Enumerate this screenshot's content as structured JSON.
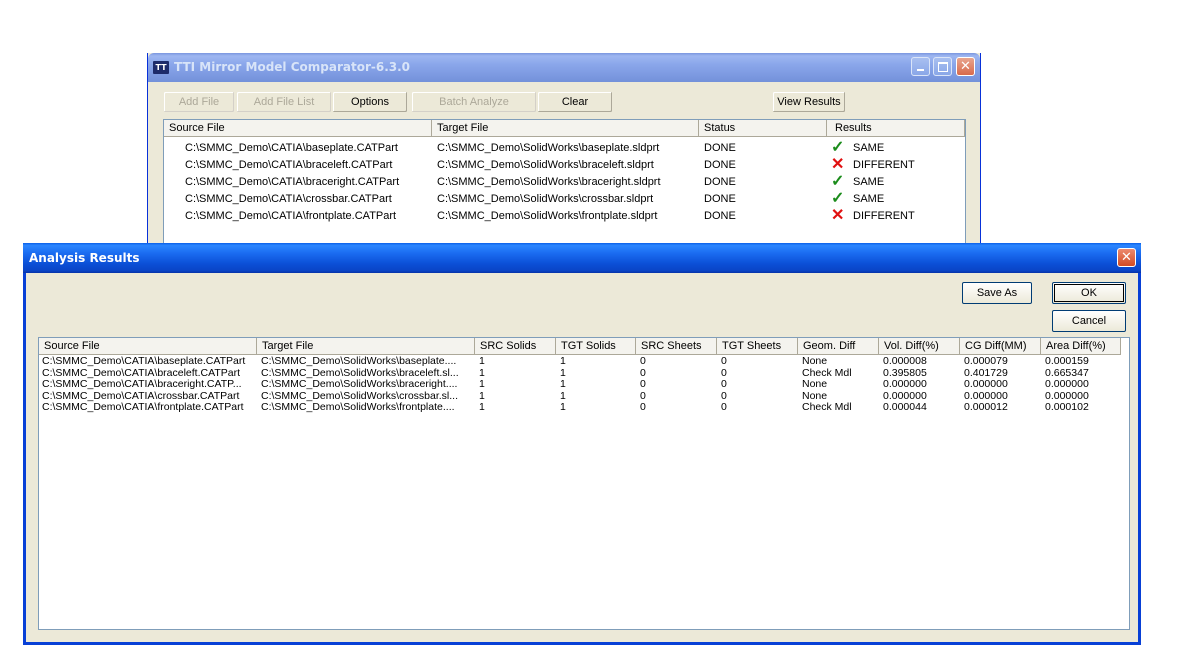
{
  "main_window": {
    "title": "TTI Mirror Model Comparator-6.3.0",
    "toolbar": {
      "add_file": "Add File",
      "add_file_list": "Add File List",
      "options": "Options",
      "batch_analyze": "Batch Analyze",
      "clear": "Clear",
      "view_results": "View Results"
    },
    "columns": [
      "Source File",
      "Target File",
      "Status",
      "Results"
    ],
    "rows": [
      {
        "source": "C:\\SMMC_Demo\\CATIA\\baseplate.CATPart",
        "target": "C:\\SMMC_Demo\\SolidWorks\\baseplate.sldprt",
        "status": "DONE",
        "result": "SAME",
        "icon": "check-icon"
      },
      {
        "source": "C:\\SMMC_Demo\\CATIA\\braceleft.CATPart",
        "target": "C:\\SMMC_Demo\\SolidWorks\\braceleft.sldprt",
        "status": "DONE",
        "result": "DIFFERENT",
        "icon": "cross-icon"
      },
      {
        "source": "C:\\SMMC_Demo\\CATIA\\braceright.CATPart",
        "target": "C:\\SMMC_Demo\\SolidWorks\\braceright.sldprt",
        "status": "DONE",
        "result": "SAME",
        "icon": "check-icon"
      },
      {
        "source": "C:\\SMMC_Demo\\CATIA\\crossbar.CATPart",
        "target": "C:\\SMMC_Demo\\SolidWorks\\crossbar.sldprt",
        "status": "DONE",
        "result": "SAME",
        "icon": "check-icon"
      },
      {
        "source": "C:\\SMMC_Demo\\CATIA\\frontplate.CATPart",
        "target": "C:\\SMMC_Demo\\SolidWorks\\frontplate.sldprt",
        "status": "DONE",
        "result": "DIFFERENT",
        "icon": "cross-icon"
      }
    ]
  },
  "results_window": {
    "title": "Analysis Results",
    "buttons": {
      "save_as": "Save As",
      "ok": "OK",
      "cancel": "Cancel"
    },
    "columns": [
      "Source File",
      "Target File",
      "SRC Solids",
      "TGT Solids",
      "SRC Sheets",
      "TGT Sheets",
      "Geom. Diff",
      "Vol. Diff(%)",
      "CG Diff(MM)",
      "Area Diff(%)"
    ],
    "rows": [
      [
        "C:\\SMMC_Demo\\CATIA\\baseplate.CATPart",
        "C:\\SMMC_Demo\\SolidWorks\\baseplate....",
        "1",
        "1",
        "0",
        "0",
        "None",
        "0.000008",
        "0.000079",
        "0.000159"
      ],
      [
        "C:\\SMMC_Demo\\CATIA\\braceleft.CATPart",
        "C:\\SMMC_Demo\\SolidWorks\\braceleft.sl...",
        "1",
        "1",
        "0",
        "0",
        "Check Mdl",
        "0.395805",
        "0.401729",
        "0.665347"
      ],
      [
        "C:\\SMMC_Demo\\CATIA\\braceright.CATP...",
        "C:\\SMMC_Demo\\SolidWorks\\braceright....",
        "1",
        "1",
        "0",
        "0",
        "None",
        "0.000000",
        "0.000000",
        "0.000000"
      ],
      [
        "C:\\SMMC_Demo\\CATIA\\crossbar.CATPart",
        "C:\\SMMC_Demo\\SolidWorks\\crossbar.sl...",
        "1",
        "1",
        "0",
        "0",
        "None",
        "0.000000",
        "0.000000",
        "0.000000"
      ],
      [
        "C:\\SMMC_Demo\\CATIA\\frontplate.CATPart",
        "C:\\SMMC_Demo\\SolidWorks\\frontplate....",
        "1",
        "1",
        "0",
        "0",
        "Check Mdl",
        "0.000044",
        "0.000012",
        "0.000102"
      ]
    ]
  },
  "colors": {
    "titlebar_active": "#0a5fe8",
    "titlebar_inactive": "#7a96df",
    "window_face": "#ece9d8",
    "same": "#1b8c1b",
    "different": "#e01010"
  }
}
